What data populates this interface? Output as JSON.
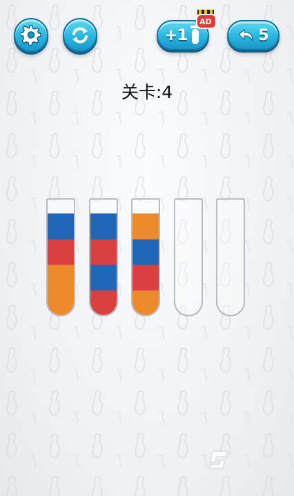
{
  "level": {
    "title": "关卡:4"
  },
  "toolbar": {
    "settings_icon": "gear-icon",
    "restart_icon": "refresh-icon",
    "add_tube_label": "+1",
    "add_tube_icon": "tube-icon",
    "ad_badge_label": "AD",
    "undo_icon": "undo-arrow-icon",
    "undo_count": "5"
  },
  "colors": {
    "blue": "#2067b7",
    "red": "#d9403f",
    "orange": "#ec8a2b",
    "button_blue": "#29b6e0"
  },
  "tubes": [
    {
      "layers": [
        "orange",
        "orange",
        "red",
        "blue"
      ]
    },
    {
      "layers": [
        "red",
        "blue",
        "red",
        "blue"
      ]
    },
    {
      "layers": [
        "orange",
        "red",
        "blue",
        "orange"
      ]
    },
    {
      "layers": []
    },
    {
      "layers": []
    }
  ]
}
